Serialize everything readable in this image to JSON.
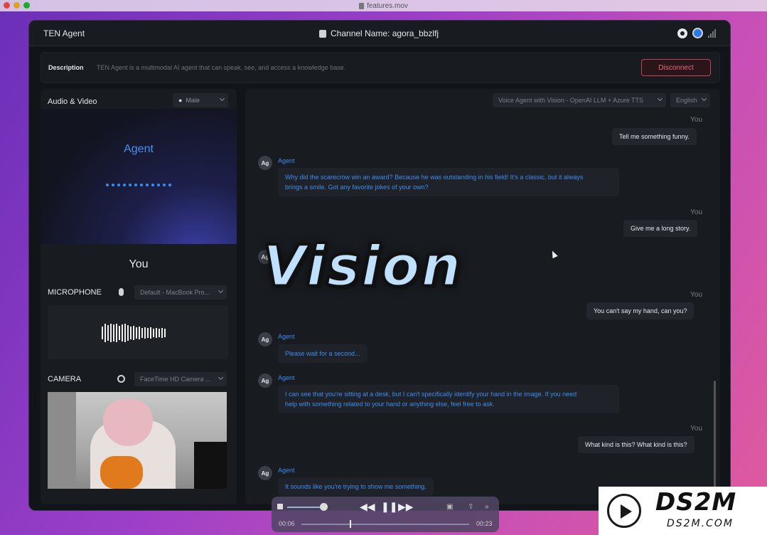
{
  "mac": {
    "file_title": "features.mov"
  },
  "header": {
    "app_name": "TEN Agent",
    "channel_label": "Channel Name: agora_bbzlfj"
  },
  "description": {
    "label": "Description",
    "text": "TEN Agent is a multimodal AI agent that can speak, see, and access a knowledge base.",
    "disconnect_label": "Disconnect"
  },
  "left": {
    "title": "Audio & Video",
    "voice": "Male",
    "agent_label": "Agent",
    "you_label": "You",
    "microphone_label": "MICROPHONE",
    "microphone_device": "Default - MacBook Pro...",
    "camera_label": "CAMERA",
    "camera_device": "FaceTime HD Camera ..."
  },
  "right": {
    "model": "Voice Agent with Vision - OpenAI LLM + Azure TTS",
    "language": "English"
  },
  "chat": {
    "you_label": "You",
    "agent_name": "Agent",
    "agent_avatar": "Ag",
    "messages": [
      {
        "role": "you",
        "text": "Tell me something funny."
      },
      {
        "role": "agent",
        "lines": [
          "Why did the scarecrow win an award? Because he was outstanding in his field! It's a classic, but it always",
          "brings a smile. Got any favorite jokes of your own?"
        ]
      },
      {
        "role": "you",
        "text": "Give me a long story."
      },
      {
        "role": "you",
        "text": "You can't say my hand, can you?"
      },
      {
        "role": "agent",
        "lines": [
          "Please wait for a second..."
        ]
      },
      {
        "role": "agent",
        "lines": [
          "I can see that you're sitting at a desk, but I can't specifically identify your hand in the image. If you need",
          "help with something related to your hand or anything else, feel free to ask."
        ]
      },
      {
        "role": "you",
        "text": "What kind is this? What kind is this?"
      },
      {
        "role": "agent",
        "lines": [
          "It sounds like you're trying to show me something."
        ]
      }
    ]
  },
  "overlay": {
    "title": "Vision"
  },
  "player": {
    "elapsed": "00:06",
    "remaining": "00:23",
    "progress_fraction": 0.29,
    "volume_fraction": 0.85
  },
  "watermark": {
    "brand": "DS2M",
    "domain": "DS2M.COM"
  }
}
